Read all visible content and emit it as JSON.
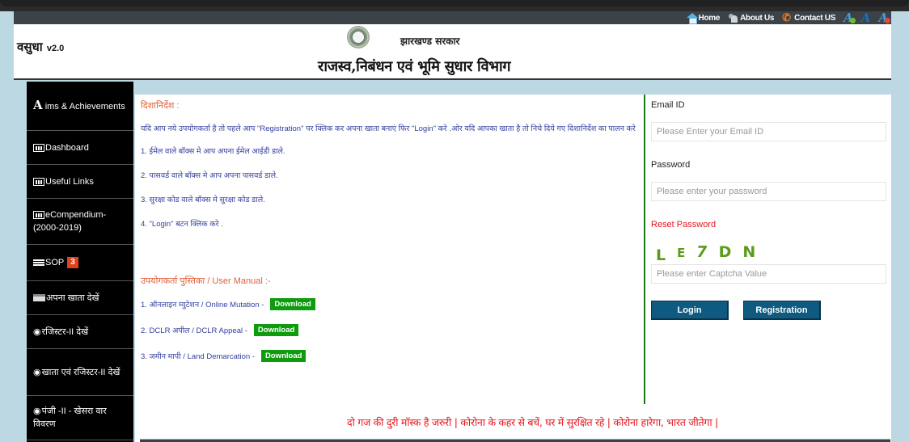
{
  "topbar": {
    "links": [
      {
        "label": "Home",
        "icon": "home-icon"
      },
      {
        "label": "About Us",
        "icon": "users-icon"
      },
      {
        "label": "Contact US",
        "icon": "phone-icon"
      }
    ],
    "font_controls": [
      {
        "label": "A",
        "action": "increase-font",
        "icon": "font-increase-icon"
      },
      {
        "label": "A",
        "action": "normal-font",
        "icon": "font-normal-icon"
      },
      {
        "label": "A",
        "action": "decrease-font",
        "icon": "font-decrease-icon"
      }
    ]
  },
  "header": {
    "brand": "वसुधा",
    "version": "v2.0",
    "gov_name": "झारखण्ड सरकार",
    "dept_name": "राजस्व,निबंधन एवं भूमि सुधार विभाग"
  },
  "sidebar": {
    "items": [
      {
        "big_letter": "A",
        "label": "ims & Achievements",
        "icon": "letter-a-icon"
      },
      {
        "label": "Dashboard",
        "icon": "chart-icon"
      },
      {
        "label": "Useful Links",
        "icon": "chart-icon"
      },
      {
        "label": "eCompendium-(2000-2019)",
        "icon": "chart-icon"
      },
      {
        "label": "SOP",
        "icon": "list-icon",
        "badge": "3"
      },
      {
        "label": "अपना खाता देखें",
        "icon": "card-icon"
      },
      {
        "label": "रजिस्टर-II देखें",
        "icon": "eye-icon"
      },
      {
        "label": "खाता एवं रजिस्टर-II देखें",
        "icon": "eye-icon"
      },
      {
        "label": "पंजी -II - खेसरा वार विवरण",
        "icon": "eye-icon"
      }
    ]
  },
  "instructions": {
    "heading": "दिशानिर्देश :",
    "intro": "यदि आप नये उपयोगकर्ता है तो पहले आप \"Registration\" पर क्लिक कर अपना खाता बनाएं फिर \"Login\" करे .ओर यदि आपका खाता है तो निचे दिये गए दिशानिर्देश का पालन करे",
    "steps": [
      "1. ईमेल वाले बॉक्स मे आप अपना ईमेल आईडी डाले.",
      "2. पासवर्ड वाले बॉक्स मे आप अपना पासवर्ड डाले.",
      "3. सुरक्षा कोड वाले बॉक्स मे सुरक्षा कोड डाले.",
      "4. \"Login\" बटन क्लिक करे ."
    ]
  },
  "manuals": {
    "heading": "उपयोगकर्ता पुस्तिका / User Manual :-",
    "items": [
      {
        "label": "1. ऑनलाइन म्युटेशन / Online Mutation -",
        "button": "Download"
      },
      {
        "label": "2. DCLR अपील / DCLR Appeal -",
        "button": "Download"
      },
      {
        "label": "3. जमीन मापी / Land Demarcation -",
        "button": "Download"
      }
    ]
  },
  "login": {
    "email_label": "Email ID",
    "email_placeholder": "Please Enter your Email ID",
    "email_value": "",
    "password_label": "Password",
    "password_placeholder": "Please enter your password",
    "password_value": "",
    "reset_label": "Reset Password",
    "captcha_chars": [
      "L",
      "E",
      "7",
      "D",
      "N"
    ],
    "captcha_placeholder": "Please enter Captcha Value",
    "captcha_value": "",
    "login_button": "Login",
    "register_button": "Registration"
  },
  "notice": "दो गज की दुरी मॉस्क है जरुरी | कोरोना के कहर से बचें, घर में सुरक्षित रहे | कोरोना हारेगा, भारत जीतेगा |",
  "colors": {
    "accent_orange": "#e0613a",
    "link_blue": "#3440a0",
    "download_green": "#0e9c0e",
    "button_blue": "#0e5a80",
    "alert_red": "#e8141c",
    "captcha_green": "#5a9c1a"
  }
}
